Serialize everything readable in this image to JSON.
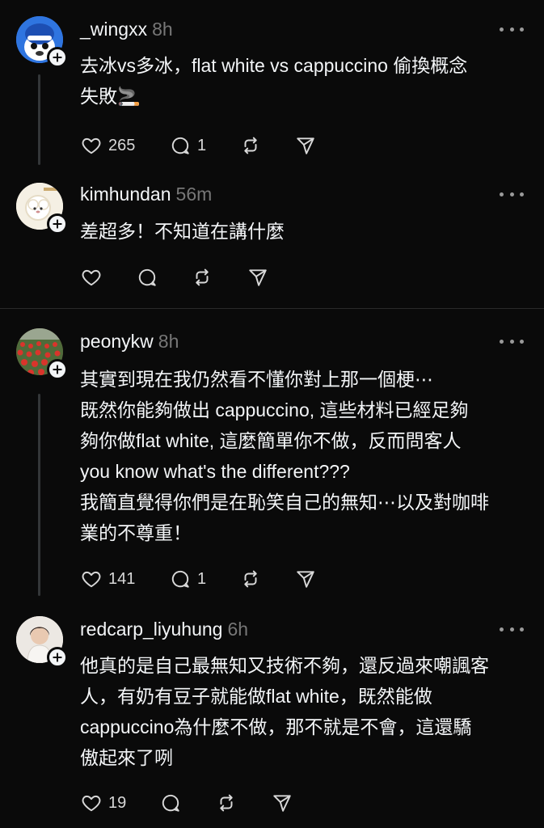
{
  "posts": [
    {
      "username": "_wingxx",
      "time": "8h",
      "text": "去冰vs多冰，flat white  vs cappuccino 偷換概念\n失敗🚬",
      "likes": "265",
      "replies": "1"
    },
    {
      "username": "kimhundan",
      "time": "56m",
      "text": "差超多！不知道在講什麼",
      "likes": "",
      "replies": ""
    },
    {
      "username": "peonykw",
      "time": "8h",
      "text": "其實到現在我仍然看不懂你對上那一個梗⋯\n既然你能夠做出 cappuccino, 這些材料已經足夠\n夠你做flat white, 這麼簡單你不做，反而問客人\nyou know what's the different???\n我簡直覺得你們是在恥笑自己的無知⋯以及對咖啡\n業的不尊重！",
      "likes": "141",
      "replies": "1"
    },
    {
      "username": "redcarp_liyuhung",
      "time": "6h",
      "text": "他真的是自己最無知又技術不夠，還反過來嘲諷客\n人，有奶有豆子就能做flat white，既然能做\ncappuccino為什麼不做，那不就是不會，這還驕\n傲起來了咧",
      "likes": "19",
      "replies": ""
    }
  ],
  "colors": {
    "background": "#0a0a0a",
    "text": "#f3f5f7",
    "muted": "#777777",
    "thread_line": "#333638"
  },
  "icons": {
    "like": "heart-icon",
    "reply": "comment-icon",
    "repost": "repost-icon",
    "share": "send-icon",
    "follow": "plus-icon",
    "more": "more-icon"
  }
}
